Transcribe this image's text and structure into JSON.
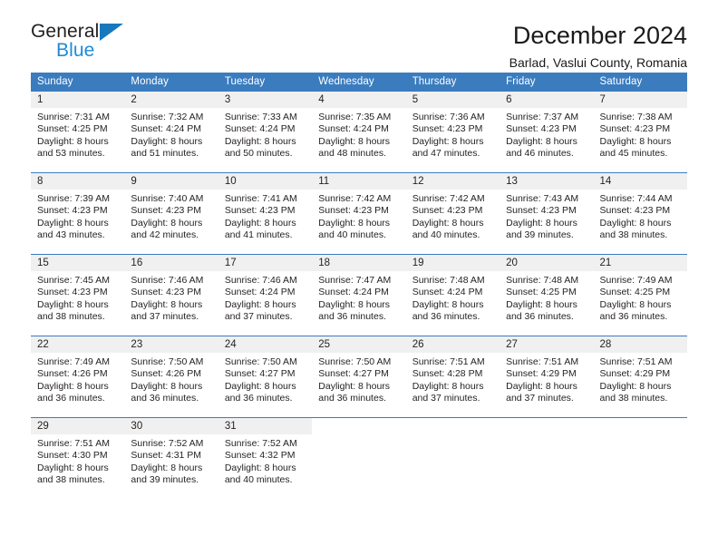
{
  "brand": {
    "name_part1": "General",
    "name_part2": "Blue",
    "accent_color": "#1878be",
    "blue_text_color": "#1f8ad6"
  },
  "header": {
    "title": "December 2024",
    "subtitle": "Barlad, Vaslui County, Romania"
  },
  "calendar": {
    "header_bg": "#3b7cbf",
    "daynum_bg": "#f0f0f0",
    "weekdays": [
      "Sunday",
      "Monday",
      "Tuesday",
      "Wednesday",
      "Thursday",
      "Friday",
      "Saturday"
    ],
    "weeks": [
      [
        {
          "day": "1",
          "sunrise": "Sunrise: 7:31 AM",
          "sunset": "Sunset: 4:25 PM",
          "daylight1": "Daylight: 8 hours",
          "daylight2": "and 53 minutes."
        },
        {
          "day": "2",
          "sunrise": "Sunrise: 7:32 AM",
          "sunset": "Sunset: 4:24 PM",
          "daylight1": "Daylight: 8 hours",
          "daylight2": "and 51 minutes."
        },
        {
          "day": "3",
          "sunrise": "Sunrise: 7:33 AM",
          "sunset": "Sunset: 4:24 PM",
          "daylight1": "Daylight: 8 hours",
          "daylight2": "and 50 minutes."
        },
        {
          "day": "4",
          "sunrise": "Sunrise: 7:35 AM",
          "sunset": "Sunset: 4:24 PM",
          "daylight1": "Daylight: 8 hours",
          "daylight2": "and 48 minutes."
        },
        {
          "day": "5",
          "sunrise": "Sunrise: 7:36 AM",
          "sunset": "Sunset: 4:23 PM",
          "daylight1": "Daylight: 8 hours",
          "daylight2": "and 47 minutes."
        },
        {
          "day": "6",
          "sunrise": "Sunrise: 7:37 AM",
          "sunset": "Sunset: 4:23 PM",
          "daylight1": "Daylight: 8 hours",
          "daylight2": "and 46 minutes."
        },
        {
          "day": "7",
          "sunrise": "Sunrise: 7:38 AM",
          "sunset": "Sunset: 4:23 PM",
          "daylight1": "Daylight: 8 hours",
          "daylight2": "and 45 minutes."
        }
      ],
      [
        {
          "day": "8",
          "sunrise": "Sunrise: 7:39 AM",
          "sunset": "Sunset: 4:23 PM",
          "daylight1": "Daylight: 8 hours",
          "daylight2": "and 43 minutes."
        },
        {
          "day": "9",
          "sunrise": "Sunrise: 7:40 AM",
          "sunset": "Sunset: 4:23 PM",
          "daylight1": "Daylight: 8 hours",
          "daylight2": "and 42 minutes."
        },
        {
          "day": "10",
          "sunrise": "Sunrise: 7:41 AM",
          "sunset": "Sunset: 4:23 PM",
          "daylight1": "Daylight: 8 hours",
          "daylight2": "and 41 minutes."
        },
        {
          "day": "11",
          "sunrise": "Sunrise: 7:42 AM",
          "sunset": "Sunset: 4:23 PM",
          "daylight1": "Daylight: 8 hours",
          "daylight2": "and 40 minutes."
        },
        {
          "day": "12",
          "sunrise": "Sunrise: 7:42 AM",
          "sunset": "Sunset: 4:23 PM",
          "daylight1": "Daylight: 8 hours",
          "daylight2": "and 40 minutes."
        },
        {
          "day": "13",
          "sunrise": "Sunrise: 7:43 AM",
          "sunset": "Sunset: 4:23 PM",
          "daylight1": "Daylight: 8 hours",
          "daylight2": "and 39 minutes."
        },
        {
          "day": "14",
          "sunrise": "Sunrise: 7:44 AM",
          "sunset": "Sunset: 4:23 PM",
          "daylight1": "Daylight: 8 hours",
          "daylight2": "and 38 minutes."
        }
      ],
      [
        {
          "day": "15",
          "sunrise": "Sunrise: 7:45 AM",
          "sunset": "Sunset: 4:23 PM",
          "daylight1": "Daylight: 8 hours",
          "daylight2": "and 38 minutes."
        },
        {
          "day": "16",
          "sunrise": "Sunrise: 7:46 AM",
          "sunset": "Sunset: 4:23 PM",
          "daylight1": "Daylight: 8 hours",
          "daylight2": "and 37 minutes."
        },
        {
          "day": "17",
          "sunrise": "Sunrise: 7:46 AM",
          "sunset": "Sunset: 4:24 PM",
          "daylight1": "Daylight: 8 hours",
          "daylight2": "and 37 minutes."
        },
        {
          "day": "18",
          "sunrise": "Sunrise: 7:47 AM",
          "sunset": "Sunset: 4:24 PM",
          "daylight1": "Daylight: 8 hours",
          "daylight2": "and 36 minutes."
        },
        {
          "day": "19",
          "sunrise": "Sunrise: 7:48 AM",
          "sunset": "Sunset: 4:24 PM",
          "daylight1": "Daylight: 8 hours",
          "daylight2": "and 36 minutes."
        },
        {
          "day": "20",
          "sunrise": "Sunrise: 7:48 AM",
          "sunset": "Sunset: 4:25 PM",
          "daylight1": "Daylight: 8 hours",
          "daylight2": "and 36 minutes."
        },
        {
          "day": "21",
          "sunrise": "Sunrise: 7:49 AM",
          "sunset": "Sunset: 4:25 PM",
          "daylight1": "Daylight: 8 hours",
          "daylight2": "and 36 minutes."
        }
      ],
      [
        {
          "day": "22",
          "sunrise": "Sunrise: 7:49 AM",
          "sunset": "Sunset: 4:26 PM",
          "daylight1": "Daylight: 8 hours",
          "daylight2": "and 36 minutes."
        },
        {
          "day": "23",
          "sunrise": "Sunrise: 7:50 AM",
          "sunset": "Sunset: 4:26 PM",
          "daylight1": "Daylight: 8 hours",
          "daylight2": "and 36 minutes."
        },
        {
          "day": "24",
          "sunrise": "Sunrise: 7:50 AM",
          "sunset": "Sunset: 4:27 PM",
          "daylight1": "Daylight: 8 hours",
          "daylight2": "and 36 minutes."
        },
        {
          "day": "25",
          "sunrise": "Sunrise: 7:50 AM",
          "sunset": "Sunset: 4:27 PM",
          "daylight1": "Daylight: 8 hours",
          "daylight2": "and 36 minutes."
        },
        {
          "day": "26",
          "sunrise": "Sunrise: 7:51 AM",
          "sunset": "Sunset: 4:28 PM",
          "daylight1": "Daylight: 8 hours",
          "daylight2": "and 37 minutes."
        },
        {
          "day": "27",
          "sunrise": "Sunrise: 7:51 AM",
          "sunset": "Sunset: 4:29 PM",
          "daylight1": "Daylight: 8 hours",
          "daylight2": "and 37 minutes."
        },
        {
          "day": "28",
          "sunrise": "Sunrise: 7:51 AM",
          "sunset": "Sunset: 4:29 PM",
          "daylight1": "Daylight: 8 hours",
          "daylight2": "and 38 minutes."
        }
      ],
      [
        {
          "day": "29",
          "sunrise": "Sunrise: 7:51 AM",
          "sunset": "Sunset: 4:30 PM",
          "daylight1": "Daylight: 8 hours",
          "daylight2": "and 38 minutes."
        },
        {
          "day": "30",
          "sunrise": "Sunrise: 7:52 AM",
          "sunset": "Sunset: 4:31 PM",
          "daylight1": "Daylight: 8 hours",
          "daylight2": "and 39 minutes."
        },
        {
          "day": "31",
          "sunrise": "Sunrise: 7:52 AM",
          "sunset": "Sunset: 4:32 PM",
          "daylight1": "Daylight: 8 hours",
          "daylight2": "and 40 minutes."
        },
        {
          "day": "",
          "sunrise": "",
          "sunset": "",
          "daylight1": "",
          "daylight2": ""
        },
        {
          "day": "",
          "sunrise": "",
          "sunset": "",
          "daylight1": "",
          "daylight2": ""
        },
        {
          "day": "",
          "sunrise": "",
          "sunset": "",
          "daylight1": "",
          "daylight2": ""
        },
        {
          "day": "",
          "sunrise": "",
          "sunset": "",
          "daylight1": "",
          "daylight2": ""
        }
      ]
    ]
  }
}
